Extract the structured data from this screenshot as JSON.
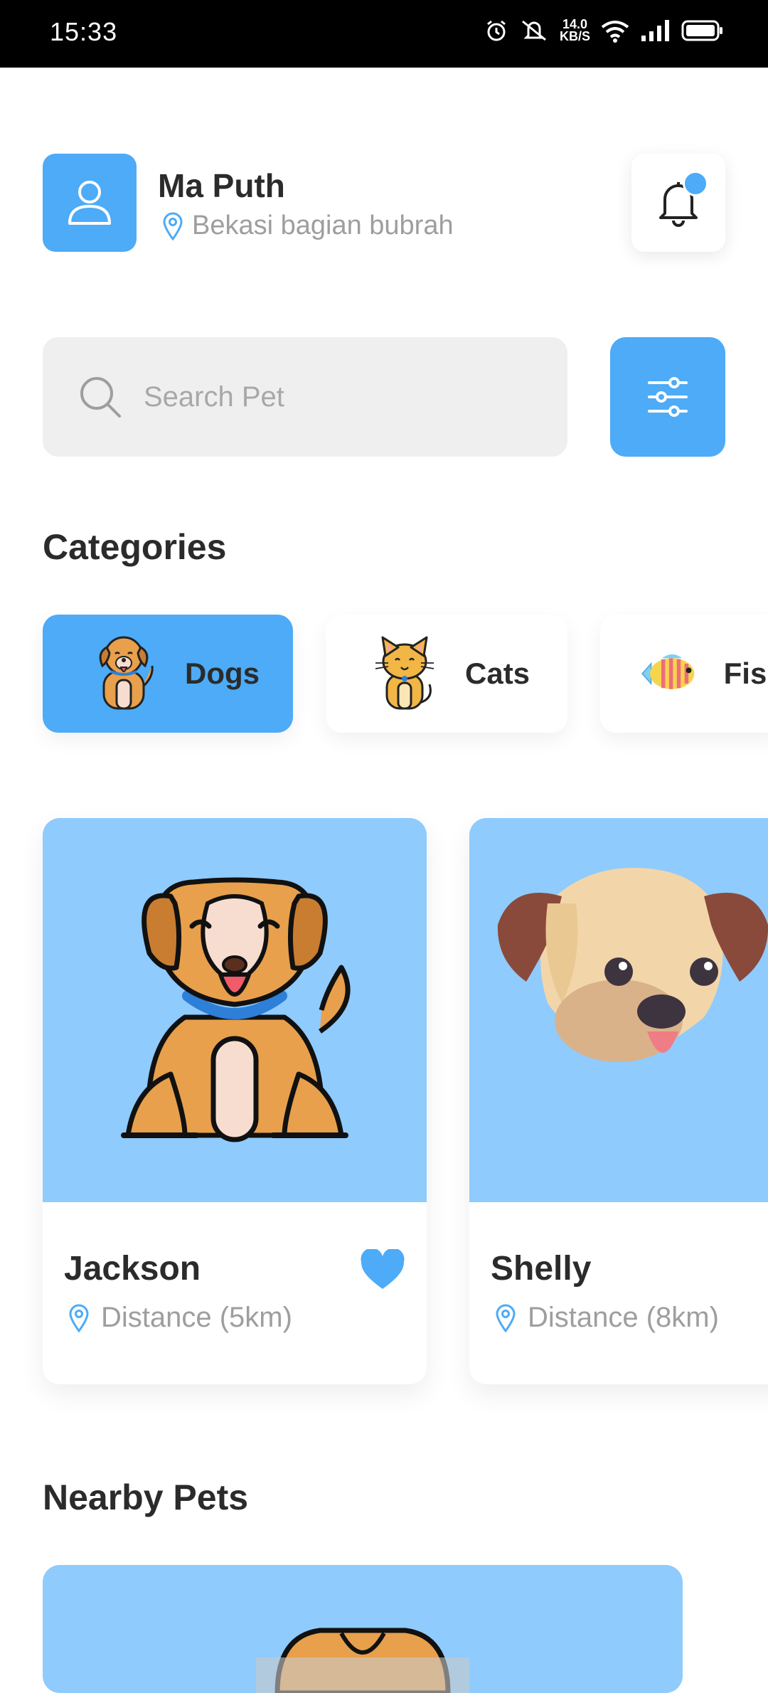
{
  "status_bar": {
    "time": "15:33",
    "net_speed_value": "14.0",
    "net_speed_unit": "KB/S"
  },
  "user": {
    "name": "Ma Puth",
    "location": "Bekasi bagian bubrah"
  },
  "search": {
    "placeholder": "Search Pet"
  },
  "categories": {
    "title": "Categories",
    "items": [
      {
        "label": "Dogs",
        "active": true
      },
      {
        "label": "Cats",
        "active": false
      },
      {
        "label": "Fish",
        "active": false
      }
    ]
  },
  "pets": [
    {
      "name": "Jackson",
      "distance": "Distance (5km)",
      "favorite": true
    },
    {
      "name": "Shelly",
      "distance": "Distance (8km)",
      "favorite": false
    }
  ],
  "nearby": {
    "title": "Nearby Pets"
  },
  "colors": {
    "accent": "#4dabf7",
    "card_image_bg": "#8fcbfd",
    "muted_text": "#9e9e9e"
  },
  "icons": [
    "alarm-icon",
    "mute-icon",
    "wifi-icon",
    "signal-icon",
    "battery-icon",
    "user-icon",
    "location-pin-icon",
    "bell-icon",
    "search-icon",
    "filter-sliders-icon",
    "heart-icon"
  ]
}
